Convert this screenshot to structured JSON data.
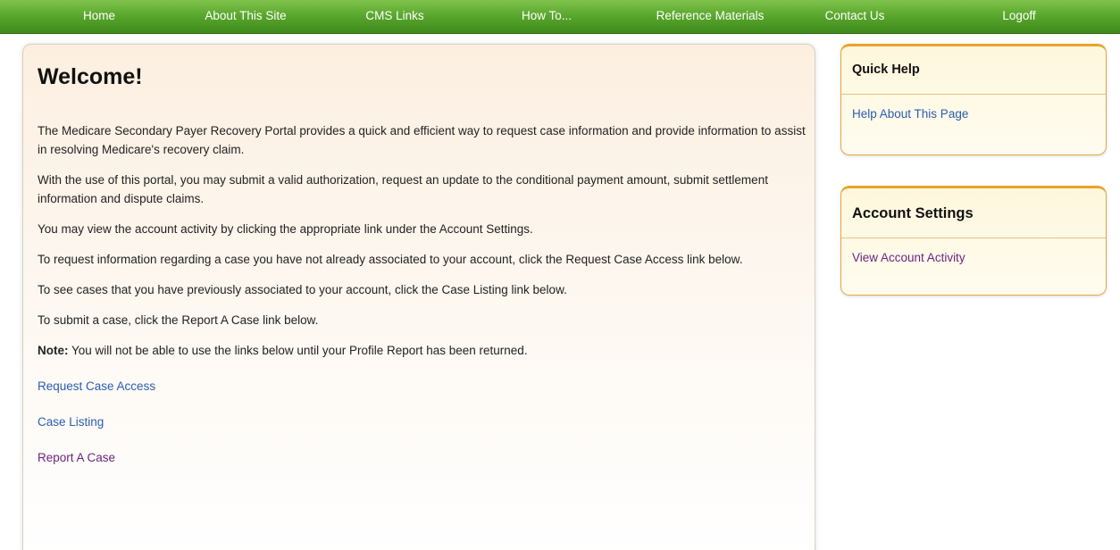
{
  "nav": {
    "items": [
      {
        "label": "Home"
      },
      {
        "label": "About This Site"
      },
      {
        "label": "CMS Links"
      },
      {
        "label": "How To..."
      },
      {
        "label": "Reference Materials"
      },
      {
        "label": "Contact Us"
      },
      {
        "label": "Logoff"
      }
    ]
  },
  "main": {
    "title": "Welcome!",
    "paragraphs": [
      "The Medicare Secondary Payer Recovery Portal provides a quick and efficient way to request case information and provide information to assist in resolving Medicare's recovery claim.",
      "With the use of this portal, you may submit a valid authorization, request an update to the conditional payment amount, submit settlement information and dispute claims.",
      "You may view the account activity by clicking the appropriate link under the Account Settings.",
      "To request information regarding a case you have not already associated to your account, click the Request Case Access link below.",
      "To see cases that you have previously associated to your account, click the Case Listing link below.",
      "To submit a case, click the Report A Case link below."
    ],
    "note_label": "Note:",
    "note_text": " You will not be able to use the links below until your Profile Report has been returned.",
    "links": {
      "request_case_access": "Request Case Access",
      "case_listing": "Case Listing",
      "report_a_case": "Report A Case"
    }
  },
  "quick_help": {
    "title": "Quick Help",
    "link": "Help About This Page"
  },
  "account_settings": {
    "title": "Account Settings",
    "link": "View Account Activity"
  },
  "colors": {
    "nav_green": "#58a52c",
    "link_blue": "#2a5db0",
    "link_visited_purple": "#6b2380",
    "side_panel_border": "#eaa12a"
  }
}
